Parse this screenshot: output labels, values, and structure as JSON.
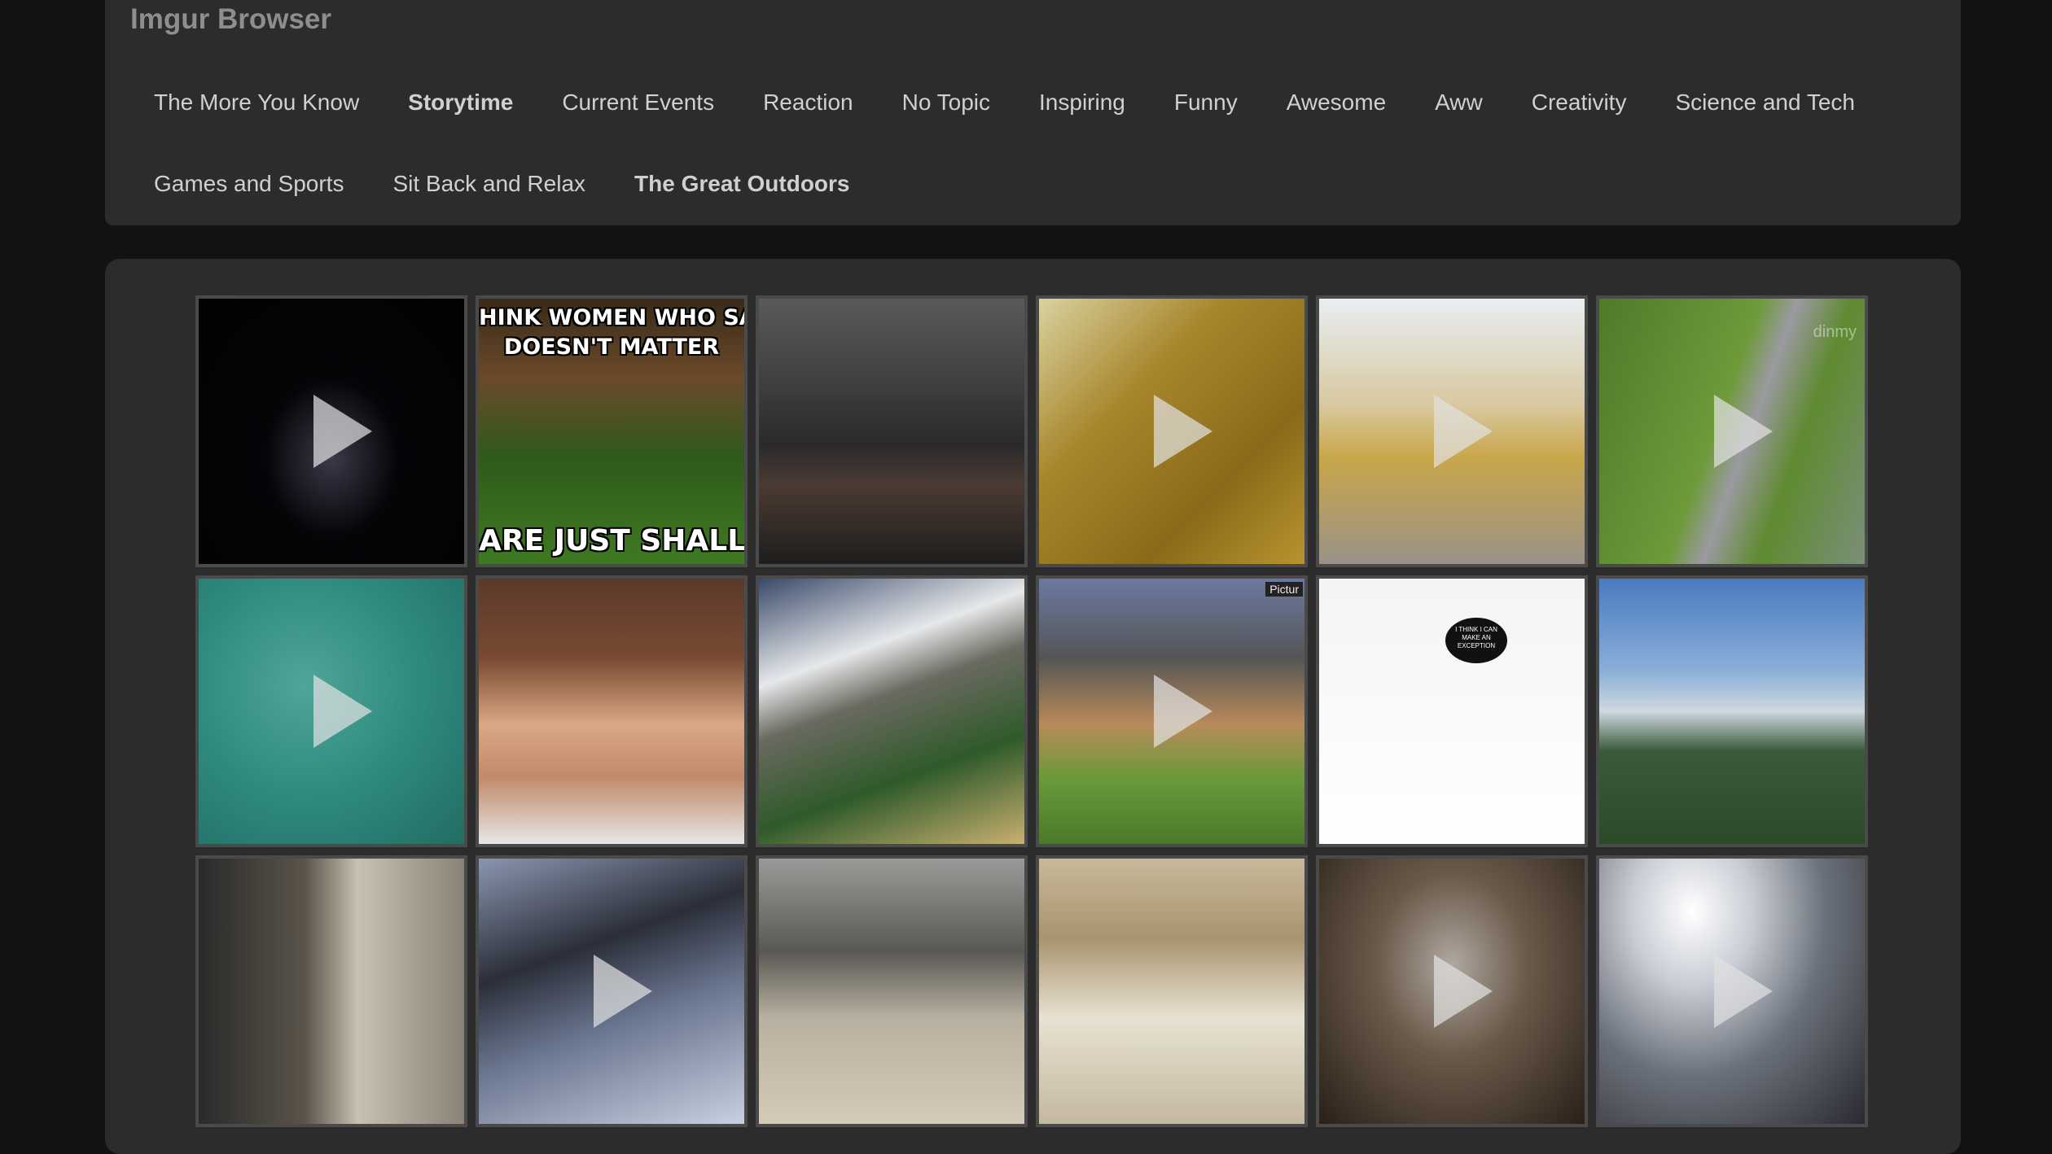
{
  "app": {
    "title": "Imgur Browser"
  },
  "topics": {
    "row1": [
      {
        "label": "The More You Know",
        "active": false
      },
      {
        "label": "Storytime",
        "active": true
      },
      {
        "label": "Current Events",
        "active": false
      },
      {
        "label": "Reaction",
        "active": false
      },
      {
        "label": "No Topic",
        "active": false
      },
      {
        "label": "Inspiring",
        "active": false
      },
      {
        "label": "Funny",
        "active": false
      },
      {
        "label": "Awesome",
        "active": false
      },
      {
        "label": "Aww",
        "active": false
      },
      {
        "label": "Creativity",
        "active": false
      },
      {
        "label": "Science and Tech",
        "active": false
      }
    ],
    "row2": [
      {
        "label": "Games and Sports",
        "active": false
      },
      {
        "label": "Sit Back and Relax",
        "active": false
      },
      {
        "label": "The Great Outdoors",
        "active": true
      }
    ]
  },
  "gallery": {
    "tiles": [
      {
        "subject": "night sky with lightning",
        "is_video": true,
        "icon": "play-icon"
      },
      {
        "subject": "puffin meme",
        "is_video": false,
        "meme_top": "HINK WOMEN WHO SAY S\nDOESN'T MATTER",
        "meme_bottom": "ARE JUST SHALLOW"
      },
      {
        "subject": "stormy mountain village",
        "is_video": false
      },
      {
        "subject": "yellow water surface",
        "is_video": true,
        "icon": "play-icon"
      },
      {
        "subject": "woman at outdoor gym",
        "is_video": true,
        "icon": "play-icon"
      },
      {
        "subject": "winding mountain road",
        "is_video": true,
        "icon": "play-icon",
        "watermark": "dinmy"
      },
      {
        "subject": "octopus in teal water",
        "is_video": true,
        "icon": "play-icon"
      },
      {
        "subject": "large moth on hand",
        "is_video": false
      },
      {
        "subject": "canyon waterfall",
        "is_video": false
      },
      {
        "subject": "house fire smoke",
        "is_video": true,
        "icon": "play-icon",
        "badge": "Pictur"
      },
      {
        "subject": "comic strip cat",
        "is_video": false,
        "speech": "I THINK I CAN MAKE AN EXCEPTION"
      },
      {
        "subject": "blue sky over plain",
        "is_video": false
      },
      {
        "subject": "snake on window blinds",
        "is_video": false
      },
      {
        "subject": "car interior dashboard",
        "is_video": true,
        "icon": "play-icon"
      },
      {
        "subject": "bald eagle with prey",
        "is_video": false
      },
      {
        "subject": "man crouching in hallway",
        "is_video": false
      },
      {
        "subject": "macro insect",
        "is_video": true,
        "icon": "play-icon"
      },
      {
        "subject": "skydive above clouds",
        "is_video": true,
        "icon": "play-icon"
      }
    ]
  },
  "colors": {
    "page_bg": "#121212",
    "panel_bg": "#2c2c2c",
    "title_text": "#8e8e8e",
    "nav_text": "#d0d0d0",
    "tile_border": "#4a4a4a"
  }
}
